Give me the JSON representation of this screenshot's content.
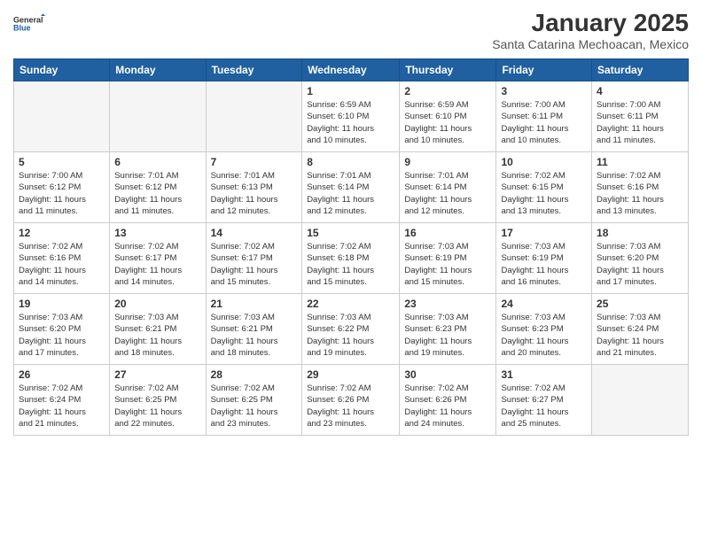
{
  "header": {
    "logo_line1": "General",
    "logo_line2": "Blue",
    "month": "January 2025",
    "location": "Santa Catarina Mechoacan, Mexico"
  },
  "weekdays": [
    "Sunday",
    "Monday",
    "Tuesday",
    "Wednesday",
    "Thursday",
    "Friday",
    "Saturday"
  ],
  "weeks": [
    [
      {
        "day": "",
        "info": ""
      },
      {
        "day": "",
        "info": ""
      },
      {
        "day": "",
        "info": ""
      },
      {
        "day": "1",
        "info": "Sunrise: 6:59 AM\nSunset: 6:10 PM\nDaylight: 11 hours\nand 10 minutes."
      },
      {
        "day": "2",
        "info": "Sunrise: 6:59 AM\nSunset: 6:10 PM\nDaylight: 11 hours\nand 10 minutes."
      },
      {
        "day": "3",
        "info": "Sunrise: 7:00 AM\nSunset: 6:11 PM\nDaylight: 11 hours\nand 10 minutes."
      },
      {
        "day": "4",
        "info": "Sunrise: 7:00 AM\nSunset: 6:11 PM\nDaylight: 11 hours\nand 11 minutes."
      }
    ],
    [
      {
        "day": "5",
        "info": "Sunrise: 7:00 AM\nSunset: 6:12 PM\nDaylight: 11 hours\nand 11 minutes."
      },
      {
        "day": "6",
        "info": "Sunrise: 7:01 AM\nSunset: 6:12 PM\nDaylight: 11 hours\nand 11 minutes."
      },
      {
        "day": "7",
        "info": "Sunrise: 7:01 AM\nSunset: 6:13 PM\nDaylight: 11 hours\nand 12 minutes."
      },
      {
        "day": "8",
        "info": "Sunrise: 7:01 AM\nSunset: 6:14 PM\nDaylight: 11 hours\nand 12 minutes."
      },
      {
        "day": "9",
        "info": "Sunrise: 7:01 AM\nSunset: 6:14 PM\nDaylight: 11 hours\nand 12 minutes."
      },
      {
        "day": "10",
        "info": "Sunrise: 7:02 AM\nSunset: 6:15 PM\nDaylight: 11 hours\nand 13 minutes."
      },
      {
        "day": "11",
        "info": "Sunrise: 7:02 AM\nSunset: 6:16 PM\nDaylight: 11 hours\nand 13 minutes."
      }
    ],
    [
      {
        "day": "12",
        "info": "Sunrise: 7:02 AM\nSunset: 6:16 PM\nDaylight: 11 hours\nand 14 minutes."
      },
      {
        "day": "13",
        "info": "Sunrise: 7:02 AM\nSunset: 6:17 PM\nDaylight: 11 hours\nand 14 minutes."
      },
      {
        "day": "14",
        "info": "Sunrise: 7:02 AM\nSunset: 6:17 PM\nDaylight: 11 hours\nand 15 minutes."
      },
      {
        "day": "15",
        "info": "Sunrise: 7:02 AM\nSunset: 6:18 PM\nDaylight: 11 hours\nand 15 minutes."
      },
      {
        "day": "16",
        "info": "Sunrise: 7:03 AM\nSunset: 6:19 PM\nDaylight: 11 hours\nand 15 minutes."
      },
      {
        "day": "17",
        "info": "Sunrise: 7:03 AM\nSunset: 6:19 PM\nDaylight: 11 hours\nand 16 minutes."
      },
      {
        "day": "18",
        "info": "Sunrise: 7:03 AM\nSunset: 6:20 PM\nDaylight: 11 hours\nand 17 minutes."
      }
    ],
    [
      {
        "day": "19",
        "info": "Sunrise: 7:03 AM\nSunset: 6:20 PM\nDaylight: 11 hours\nand 17 minutes."
      },
      {
        "day": "20",
        "info": "Sunrise: 7:03 AM\nSunset: 6:21 PM\nDaylight: 11 hours\nand 18 minutes."
      },
      {
        "day": "21",
        "info": "Sunrise: 7:03 AM\nSunset: 6:21 PM\nDaylight: 11 hours\nand 18 minutes."
      },
      {
        "day": "22",
        "info": "Sunrise: 7:03 AM\nSunset: 6:22 PM\nDaylight: 11 hours\nand 19 minutes."
      },
      {
        "day": "23",
        "info": "Sunrise: 7:03 AM\nSunset: 6:23 PM\nDaylight: 11 hours\nand 19 minutes."
      },
      {
        "day": "24",
        "info": "Sunrise: 7:03 AM\nSunset: 6:23 PM\nDaylight: 11 hours\nand 20 minutes."
      },
      {
        "day": "25",
        "info": "Sunrise: 7:03 AM\nSunset: 6:24 PM\nDaylight: 11 hours\nand 21 minutes."
      }
    ],
    [
      {
        "day": "26",
        "info": "Sunrise: 7:02 AM\nSunset: 6:24 PM\nDaylight: 11 hours\nand 21 minutes."
      },
      {
        "day": "27",
        "info": "Sunrise: 7:02 AM\nSunset: 6:25 PM\nDaylight: 11 hours\nand 22 minutes."
      },
      {
        "day": "28",
        "info": "Sunrise: 7:02 AM\nSunset: 6:25 PM\nDaylight: 11 hours\nand 23 minutes."
      },
      {
        "day": "29",
        "info": "Sunrise: 7:02 AM\nSunset: 6:26 PM\nDaylight: 11 hours\nand 23 minutes."
      },
      {
        "day": "30",
        "info": "Sunrise: 7:02 AM\nSunset: 6:26 PM\nDaylight: 11 hours\nand 24 minutes."
      },
      {
        "day": "31",
        "info": "Sunrise: 7:02 AM\nSunset: 6:27 PM\nDaylight: 11 hours\nand 25 minutes."
      },
      {
        "day": "",
        "info": ""
      }
    ]
  ]
}
